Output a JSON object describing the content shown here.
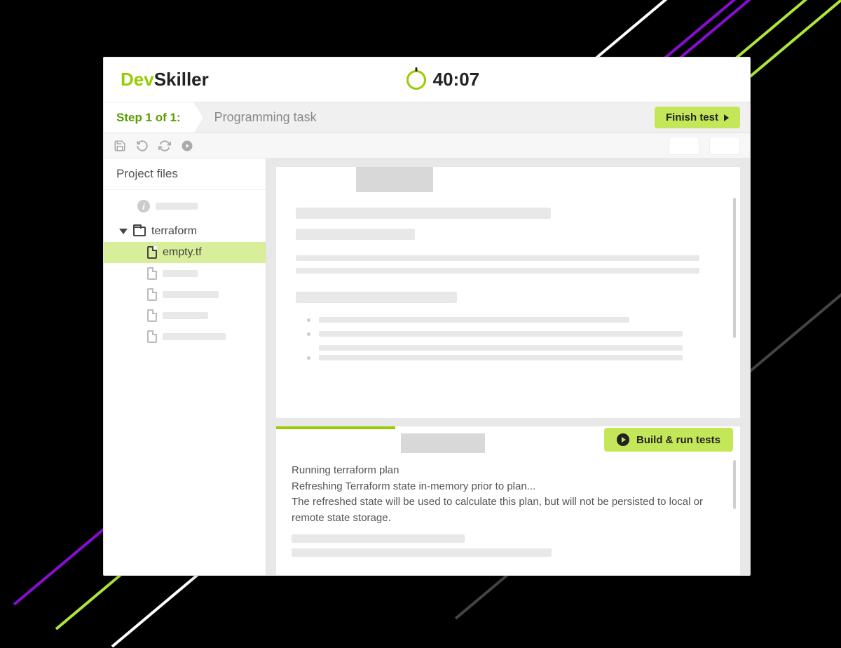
{
  "brand": {
    "prefix": "Dev",
    "suffix": "Skiller"
  },
  "timer": "40:07",
  "stepbar": {
    "step": "Step 1 of 1:",
    "label": "Programming task",
    "finish": "Finish test"
  },
  "sidebar": {
    "title": "Project files",
    "folder": "terraform",
    "active_file": "empty.tf"
  },
  "console": {
    "build_label": "Build & run tests",
    "lines": [
      "Running terraform plan",
      "Refreshing Terraform state in-memory prior to plan...",
      "The refreshed state will be used to calculate this plan, but will not be persisted to local or remote state storage."
    ]
  }
}
